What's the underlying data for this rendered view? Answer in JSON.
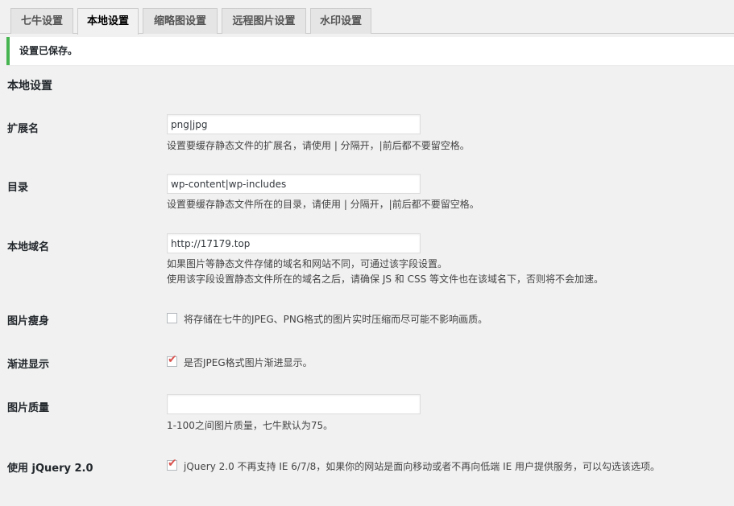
{
  "tabs": [
    {
      "label": "七牛设置",
      "active": false
    },
    {
      "label": "本地设置",
      "active": true
    },
    {
      "label": "缩略图设置",
      "active": false
    },
    {
      "label": "远程图片设置",
      "active": false
    },
    {
      "label": "水印设置",
      "active": false
    }
  ],
  "notice": "设置已保存。",
  "section_title": "本地设置",
  "fields": {
    "ext": {
      "label": "扩展名",
      "value": "png|jpg",
      "desc": "设置要缓存静态文件的扩展名，请使用 | 分隔开，|前后都不要留空格。"
    },
    "dir": {
      "label": "目录",
      "value": "wp-content|wp-includes",
      "desc": "设置要缓存静态文件所在的目录，请使用 | 分隔开，|前后都不要留空格。"
    },
    "domain": {
      "label": "本地域名",
      "value": "http://17179.top",
      "desc1": "如果图片等静态文件存储的域名和网站不同，可通过该字段设置。",
      "desc2": "使用该字段设置静态文件所在的域名之后，请确保 JS 和 CSS 等文件也在该域名下，否则将不会加速。"
    },
    "slim": {
      "label": "图片瘦身",
      "checked": false,
      "text": "将存储在七牛的JPEG、PNG格式的图片实时压缩而尽可能不影响画质。"
    },
    "progressive": {
      "label": "渐进显示",
      "checked": true,
      "text": "是否JPEG格式图片渐进显示。"
    },
    "quality": {
      "label": "图片质量",
      "value": "",
      "desc": "1-100之间图片质量，七牛默认为75。"
    },
    "jquery": {
      "label": "使用 jQuery 2.0",
      "checked": true,
      "text": "jQuery 2.0 不再支持 IE 6/7/8，如果你的网站是面向移动或者不再向低端 IE 用户提供服务，可以勾选该选项。"
    }
  },
  "colors": {
    "notice_border": "#46b450",
    "check_mark": "#d9534f"
  }
}
